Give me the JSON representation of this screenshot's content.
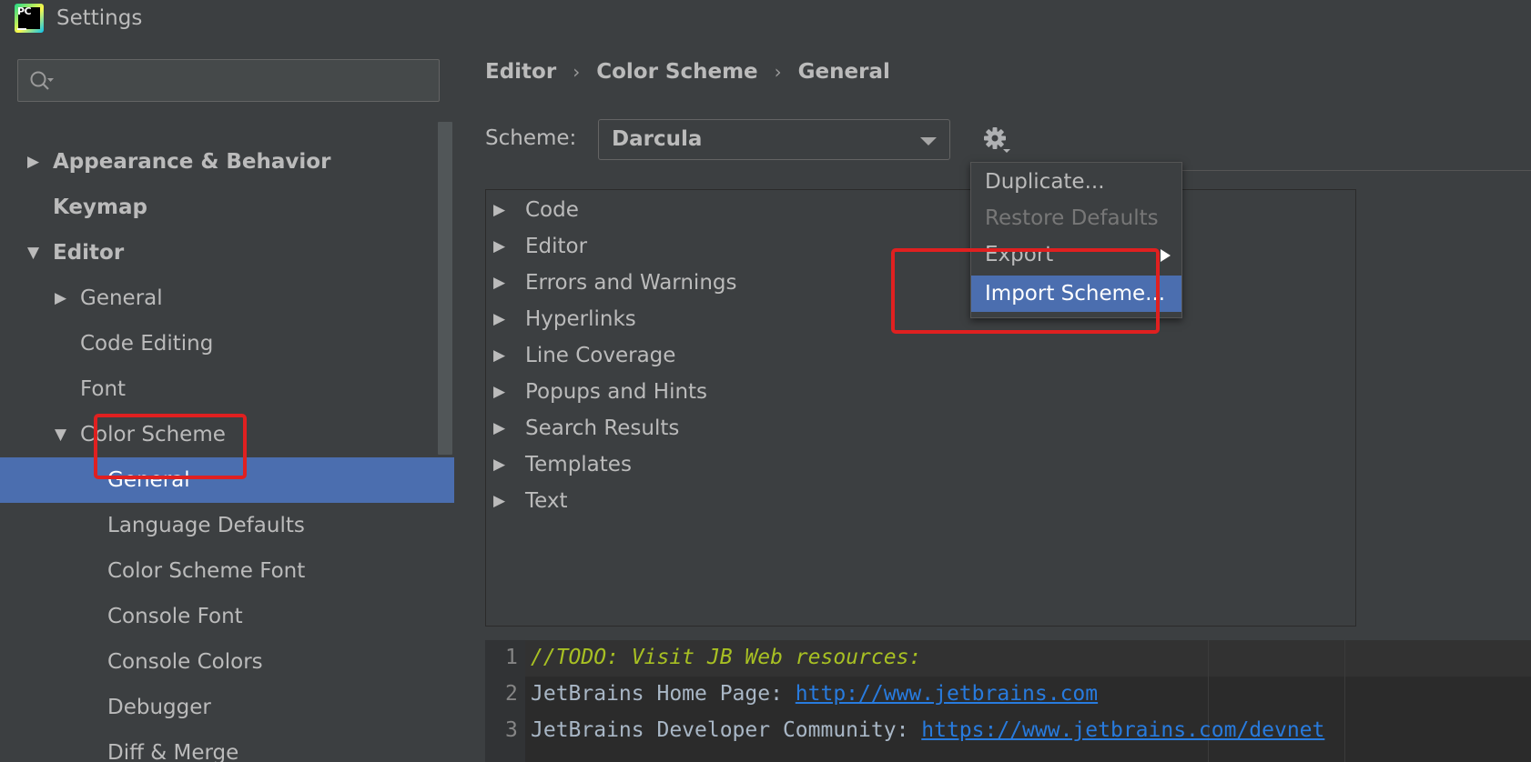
{
  "window": {
    "title": "Settings",
    "logo_text": "PC"
  },
  "sidebar": {
    "search": {
      "value": "",
      "placeholder": ""
    },
    "items": [
      {
        "label": "Appearance & Behavior",
        "level": 0,
        "expander": "collapsed",
        "bold": true
      },
      {
        "label": "Keymap",
        "level": 0,
        "expander": "none",
        "bold": true
      },
      {
        "label": "Editor",
        "level": 0,
        "expander": "expanded",
        "bold": true
      },
      {
        "label": "General",
        "level": 1,
        "expander": "collapsed",
        "bold": false
      },
      {
        "label": "Code Editing",
        "level": 1,
        "expander": "none",
        "bold": false
      },
      {
        "label": "Font",
        "level": 1,
        "expander": "none",
        "bold": false
      },
      {
        "label": "Color Scheme",
        "level": 1,
        "expander": "expanded",
        "bold": false
      },
      {
        "label": "General",
        "level": 2,
        "expander": "none",
        "bold": false,
        "selected": true
      },
      {
        "label": "Language Defaults",
        "level": 2,
        "expander": "none",
        "bold": false
      },
      {
        "label": "Color Scheme Font",
        "level": 2,
        "expander": "none",
        "bold": false
      },
      {
        "label": "Console Font",
        "level": 2,
        "expander": "none",
        "bold": false
      },
      {
        "label": "Console Colors",
        "level": 2,
        "expander": "none",
        "bold": false
      },
      {
        "label": "Debugger",
        "level": 2,
        "expander": "none",
        "bold": false
      },
      {
        "label": "Diff & Merge",
        "level": 2,
        "expander": "none",
        "bold": false
      }
    ]
  },
  "main": {
    "breadcrumb": [
      "Editor",
      "Color Scheme",
      "General"
    ],
    "breadcrumb_separator": "›",
    "scheme_label": "Scheme:",
    "scheme_value": "Darcula",
    "categories": [
      "Code",
      "Editor",
      "Errors and Warnings",
      "Hyperlinks",
      "Line Coverage",
      "Popups and Hints",
      "Search Results",
      "Templates",
      "Text"
    ],
    "gear_menu": {
      "items": [
        {
          "label": "Duplicate...",
          "state": "normal"
        },
        {
          "label": "Restore Defaults",
          "state": "disabled"
        },
        {
          "label": "Export",
          "state": "normal",
          "submenu": true
        },
        {
          "label": "Import Scheme...",
          "state": "active"
        }
      ]
    },
    "preview": {
      "lines": [
        {
          "num": "1",
          "parts": [
            {
              "text": "//TODO: Visit JB Web resources:",
              "kind": "todo"
            }
          ]
        },
        {
          "num": "2",
          "parts": [
            {
              "text": "JetBrains Home Page: ",
              "kind": "plain"
            },
            {
              "text": "http://www.jetbrains.com",
              "kind": "link"
            }
          ]
        },
        {
          "num": "3",
          "parts": [
            {
              "text": "JetBrains Developer Community: ",
              "kind": "plain"
            },
            {
              "text": "https://www.jetbrains.com/devnet",
              "kind": "link"
            }
          ]
        }
      ]
    }
  },
  "colors": {
    "background": "#3c3f41",
    "selection": "#4b6eaf",
    "annotation": "#e02020",
    "todo": "#a8c023",
    "link": "#287bde"
  },
  "icons": {
    "logo": "pycharm-logo-icon",
    "search": "search-icon",
    "gear": "gear-icon",
    "collapsed": "triangle-right-icon",
    "expanded": "triangle-down-icon",
    "dropdown": "caret-down-icon",
    "submenu": "submenu-arrow-icon"
  }
}
